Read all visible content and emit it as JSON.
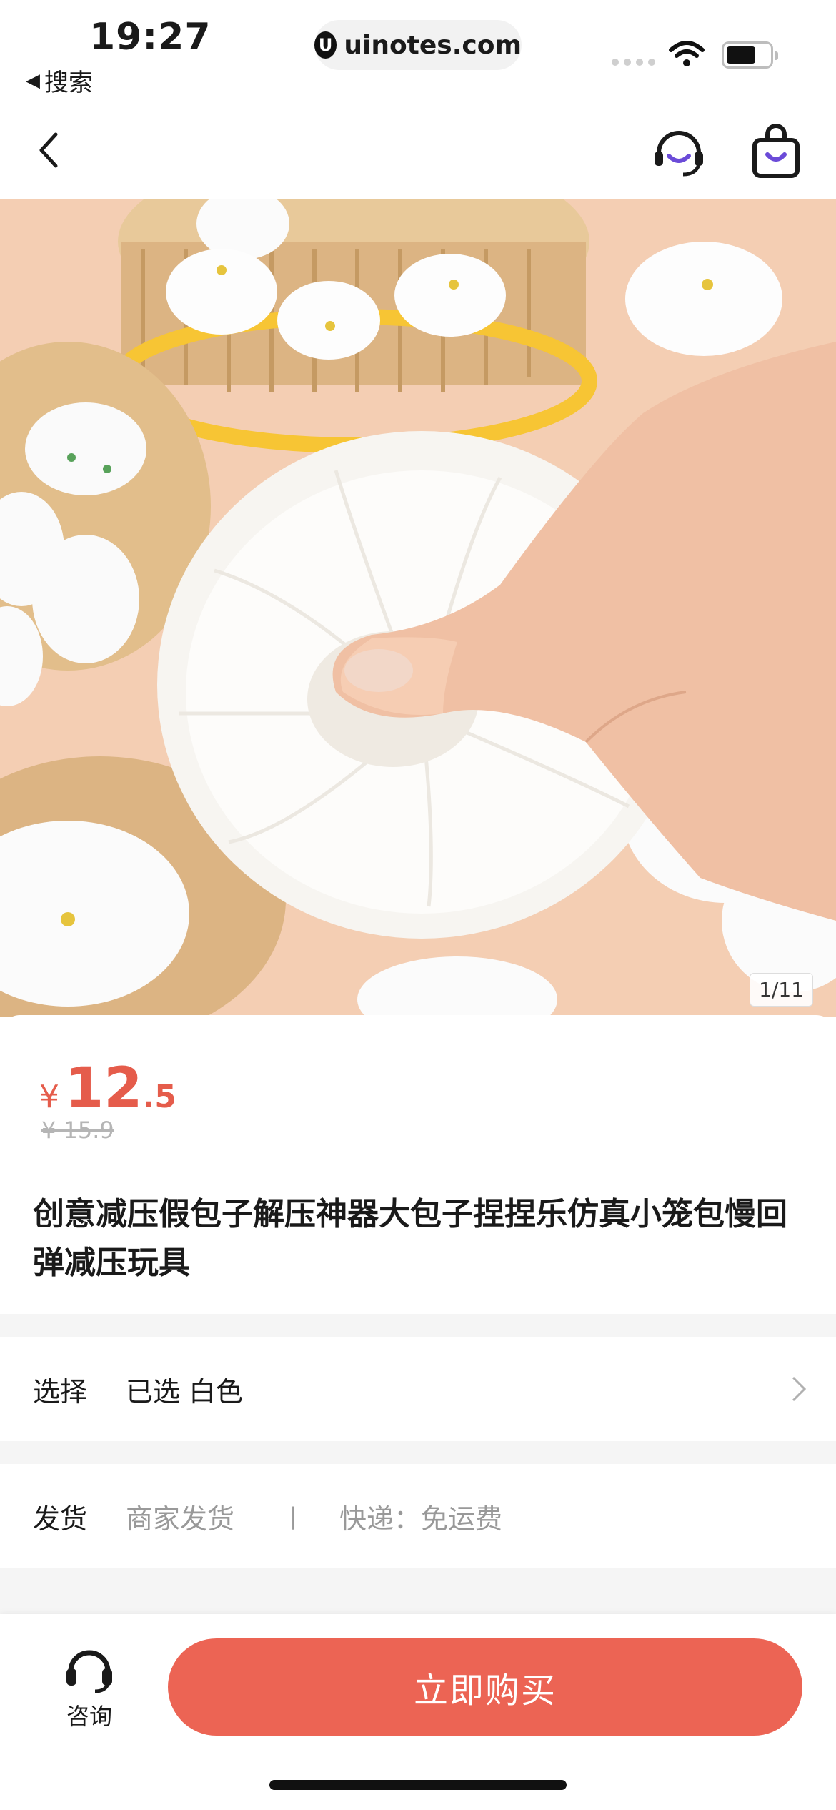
{
  "status_bar": {
    "time": "19:27",
    "back_app": "搜索",
    "url": "uinotes.com"
  },
  "nav": {
    "back_icon": "chevron-left-icon",
    "service_icon": "customer-service-icon",
    "cart_icon": "shopping-bag-icon",
    "accent_color": "#6b4bd8"
  },
  "hero": {
    "counter": "1/11"
  },
  "product": {
    "currency": "¥",
    "price_int": "12",
    "price_dec": ".5",
    "original_price": "¥ 15.9",
    "title": "创意减压假包子解压神器大包子捏捏乐仿真小笼包慢回弹减压玩具",
    "price_color": "#e55c4b"
  },
  "options": {
    "select_label": "选择",
    "select_value": "已选 白色",
    "shipping_label": "发货",
    "shipping_value": "商家发货",
    "shipping_separator": "|",
    "shipping_express": "快递：免运费"
  },
  "bottom_bar": {
    "consult_label": "咨询",
    "consult_icon": "headset-icon",
    "buy_label": "立即购买",
    "buy_color": "#ec6454"
  }
}
